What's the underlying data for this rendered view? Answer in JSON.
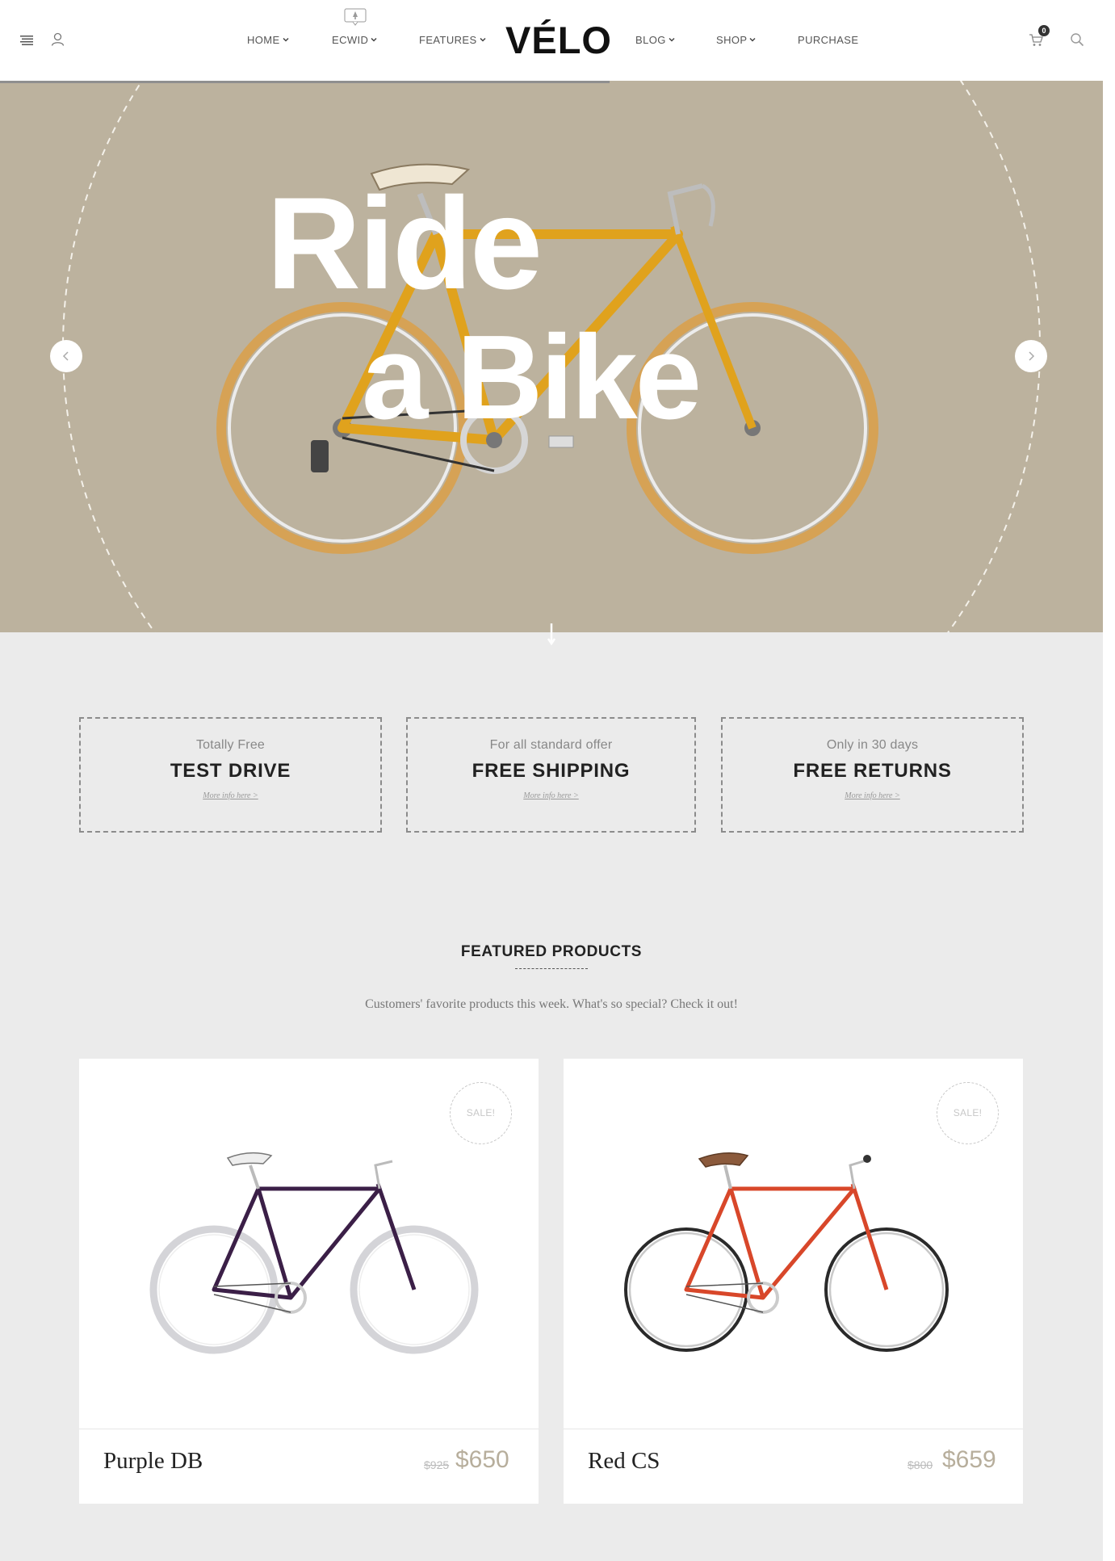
{
  "header": {
    "icons": {
      "menu": "menu-icon",
      "user": "user-icon",
      "cart": "cart-icon",
      "search": "search-icon"
    },
    "nav_left": [
      {
        "label": "HOME",
        "has_dropdown": true
      },
      {
        "label": "ECWID",
        "has_dropdown": true
      },
      {
        "label": "FEATURES",
        "has_dropdown": true
      }
    ],
    "logo": "VÉLO",
    "nav_right": [
      {
        "label": "BLOG",
        "has_dropdown": true
      },
      {
        "label": "SHOP",
        "has_dropdown": true
      },
      {
        "label": "PURCHASE",
        "has_dropdown": false
      }
    ],
    "cart_count": "0"
  },
  "hero": {
    "line1": "Ride",
    "line2": "a Bike",
    "background_color": "#bcb29e",
    "bike_frame_color": "#e0a21d"
  },
  "features": [
    {
      "subtitle": "Totally Free",
      "title": "TEST DRIVE",
      "link": "More info here >"
    },
    {
      "subtitle": "For all standard offer",
      "title": "FREE SHIPPING",
      "link": "More info here >"
    },
    {
      "subtitle": "Only in 30 days",
      "title": "FREE RETURNS",
      "link": "More info here >"
    }
  ],
  "featured": {
    "title": "FEATURED PRODUCTS",
    "description": "Customers' favorite products this week. What's so special? Check it out!"
  },
  "products": [
    {
      "name": "Purple DB",
      "old_price": "$925",
      "price": "$650",
      "badge": "SALE!",
      "frame_color": "#3b1f47",
      "tire_color": "#d4d4d8"
    },
    {
      "name": "Red CS",
      "old_price": "$800",
      "price": "$659",
      "badge": "SALE!",
      "frame_color": "#d8472a",
      "tire_color": "#2a2a2a"
    }
  ],
  "colors": {
    "accent": "#b7ae9c",
    "page_background": "#ebebeb"
  }
}
